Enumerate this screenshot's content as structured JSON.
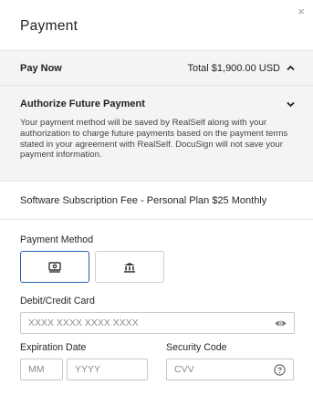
{
  "header": {
    "title": "Payment",
    "close_symbol": "×"
  },
  "pay_now": {
    "label": "Pay Now",
    "total": "Total $1,900.00 USD"
  },
  "authorize": {
    "title": "Authorize Future Payment",
    "description": "Your payment method will be saved by RealSelf along with your authorization to charge future payments based on the payment terms stated in your agreement with RealSelf. DocuSign will not save your payment information."
  },
  "subscription": {
    "text": "Software Subscription Fee - Personal Plan $25 Monthly"
  },
  "form": {
    "payment_method_label": "Payment Method",
    "card_label": "Debit/Credit Card",
    "card_placeholder": "XXXX XXXX XXXX XXXX",
    "expiration_label": "Expiration Date",
    "mm_placeholder": "MM",
    "yyyy_placeholder": "YYYY",
    "security_label": "Security Code",
    "cvv_placeholder": "CVV"
  },
  "colors": {
    "accent": "#2a63b8",
    "panel_gray": "#f4f4f4"
  },
  "icons": [
    "close-icon",
    "chevron-up-icon",
    "chevron-down-icon",
    "card-icon",
    "bank-icon",
    "eye-icon",
    "help-icon"
  ]
}
